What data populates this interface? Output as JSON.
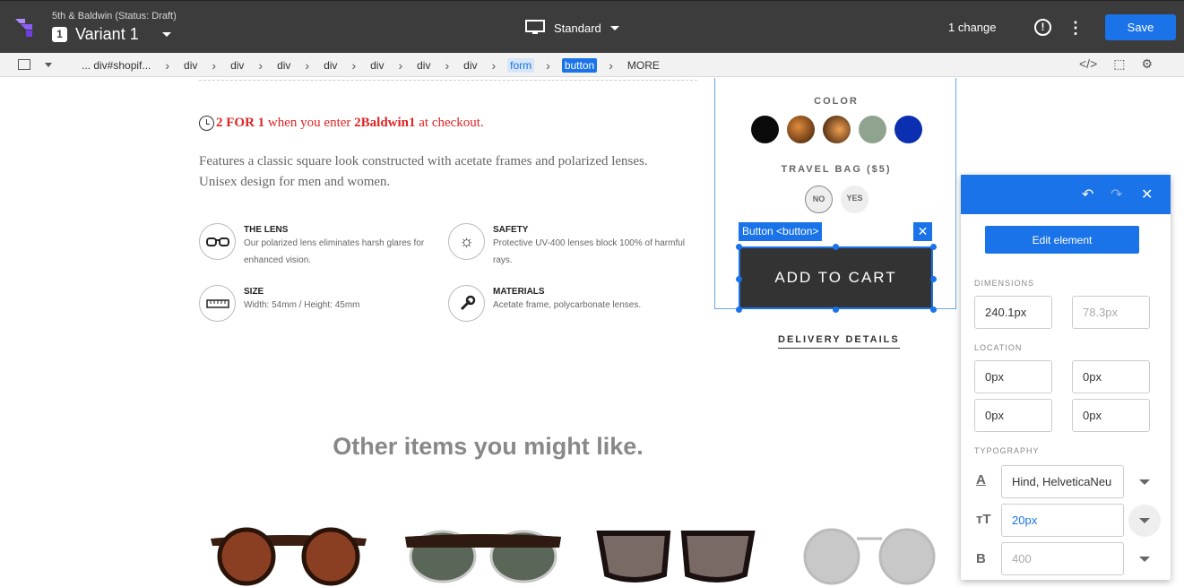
{
  "topbar": {
    "project_name": "5th & Baldwin (Status: Draft)",
    "variant_number": "1",
    "variant_name": "Variant 1",
    "device": "Standard",
    "changes": "1 change",
    "info_icon": "!",
    "kebab_icon": "⋮",
    "save_label": "Save"
  },
  "breadcrumb": {
    "items": [
      "... div#shopif...",
      "div",
      "div",
      "div",
      "div",
      "div",
      "div",
      "div",
      "form",
      "button"
    ],
    "more_label": "MORE",
    "sep": "›",
    "icons": [
      "</>",
      "⬚",
      "⚙"
    ]
  },
  "page": {
    "promo_bold_1": "2 FOR 1",
    "promo_mid": " when you enter ",
    "promo_bold_2": "2Baldwin1",
    "promo_end": " at checkout.",
    "description": "Features a classic square look constructed with acetate frames and polarized lenses. Unisex design for men and women.",
    "features": [
      {
        "title": "THE LENS",
        "text": "Our polarized lens eliminates harsh glares for enhanced vision.",
        "icon": "glasses-icon",
        "glyph": "👓"
      },
      {
        "title": "SAFETY",
        "text": "Protective UV-400 lenses block 100% of harmful rays.",
        "icon": "sun-icon",
        "glyph": "☼"
      },
      {
        "title": "SIZE",
        "text": "Width: 54mm / Height: 45mm",
        "icon": "ruler-icon",
        "glyph": "▭"
      },
      {
        "title": "MATERIALS",
        "text": "Acetate frame, polycarbonate lenses.",
        "icon": "wrench-icon",
        "glyph": "🔧"
      }
    ],
    "color_label": "COLOR",
    "swatch_colors": [
      "#0a0a0a",
      "#7a3d14",
      "#8a4a1e",
      "#8fa38f",
      "#0a2fb0"
    ],
    "travel_bag_label": "TRAVEL BAG ($5)",
    "bag_no": "NO",
    "bag_yes": "YES",
    "selection_tag": "Button <button>",
    "selection_close": "✕",
    "add_to_cart": "ADD TO CART",
    "delivery": "DELIVERY DETAILS",
    "others_title": "Other items you might like."
  },
  "inspector": {
    "undo_icon": "↶",
    "redo_icon": "↷",
    "close_icon": "✕",
    "edit_label": "Edit element",
    "dimensions_label": "DIMENSIONS",
    "width": "240.1px",
    "height": "78.3px",
    "location_label": "LOCATION",
    "loc_top": "0px",
    "loc_right": "0px",
    "loc_bottom": "0px",
    "loc_left": "0px",
    "typography_label": "TYPOGRAPHY",
    "font_family": "Hind, HelveticaNeu",
    "font_size": "20px",
    "font_weight": "400",
    "glyph_a": "A",
    "glyph_tt": "тT",
    "glyph_b": "B"
  }
}
